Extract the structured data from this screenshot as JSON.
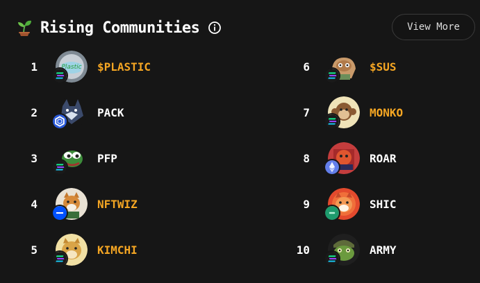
{
  "header": {
    "title": "Rising Communities",
    "view_more_label": "View More"
  },
  "colors": {
    "highlight": "#f5a623",
    "text": "#ffffff",
    "background": "#161616"
  },
  "communities": [
    {
      "rank": "1",
      "name": "$PLASTIC",
      "highlight": true,
      "chain": "solana",
      "avatar": "plastic"
    },
    {
      "rank": "2",
      "name": "PACK",
      "highlight": false,
      "chain": "chainlink",
      "avatar": "wolf"
    },
    {
      "rank": "3",
      "name": "PFP",
      "highlight": false,
      "chain": "solana",
      "avatar": "pepe"
    },
    {
      "rank": "4",
      "name": "NFTWIZ",
      "highlight": true,
      "chain": "base",
      "avatar": "dog"
    },
    {
      "rank": "5",
      "name": "KIMCHI",
      "highlight": true,
      "chain": "solana",
      "avatar": "doge"
    },
    {
      "rank": "6",
      "name": "$SUS",
      "highlight": true,
      "chain": "solana",
      "avatar": "sus"
    },
    {
      "rank": "7",
      "name": "MONKO",
      "highlight": true,
      "chain": "solana",
      "avatar": "monkey"
    },
    {
      "rank": "8",
      "name": "ROAR",
      "highlight": false,
      "chain": "ethereum",
      "avatar": "lion"
    },
    {
      "rank": "9",
      "name": "SHIC",
      "highlight": false,
      "chain": "other",
      "avatar": "shiba"
    },
    {
      "rank": "10",
      "name": "ARMY",
      "highlight": false,
      "chain": "solana",
      "avatar": "frog"
    }
  ]
}
